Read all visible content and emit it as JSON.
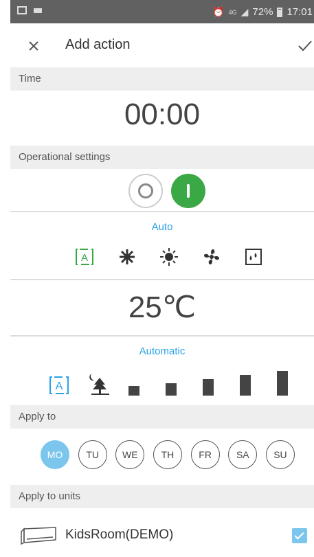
{
  "statusbar": {
    "battery": "72%",
    "time": "17:01",
    "network": "4G"
  },
  "appbar": {
    "title": "Add action"
  },
  "time_section": {
    "header": "Time",
    "value": "00:00"
  },
  "operational": {
    "header": "Operational settings",
    "power_state": "on",
    "accent_color": "#3aa845"
  },
  "mode": {
    "label": "Auto",
    "options": [
      "auto-mode",
      "cool-snowflake",
      "heat-sun",
      "fan",
      "dry"
    ],
    "selected": "auto-mode",
    "label_color": "#29a3e8"
  },
  "temperature": {
    "value": "25℃"
  },
  "fan_speed": {
    "label": "Automatic",
    "options": [
      "auto-fan",
      "night-quiet",
      "speed-1",
      "speed-2",
      "speed-3",
      "speed-4",
      "speed-5"
    ],
    "selected": "auto-fan"
  },
  "apply_to": {
    "header": "Apply to",
    "days": [
      {
        "label": "MO",
        "selected": true
      },
      {
        "label": "TU",
        "selected": false
      },
      {
        "label": "WE",
        "selected": false
      },
      {
        "label": "TH",
        "selected": false
      },
      {
        "label": "FR",
        "selected": false
      },
      {
        "label": "SA",
        "selected": false
      },
      {
        "label": "SU",
        "selected": false
      }
    ],
    "selected_color": "#7cc6ee"
  },
  "apply_to_units": {
    "header": "Apply to units",
    "units": [
      {
        "name": "KidsRoom(DEMO)",
        "checked": true
      }
    ]
  }
}
